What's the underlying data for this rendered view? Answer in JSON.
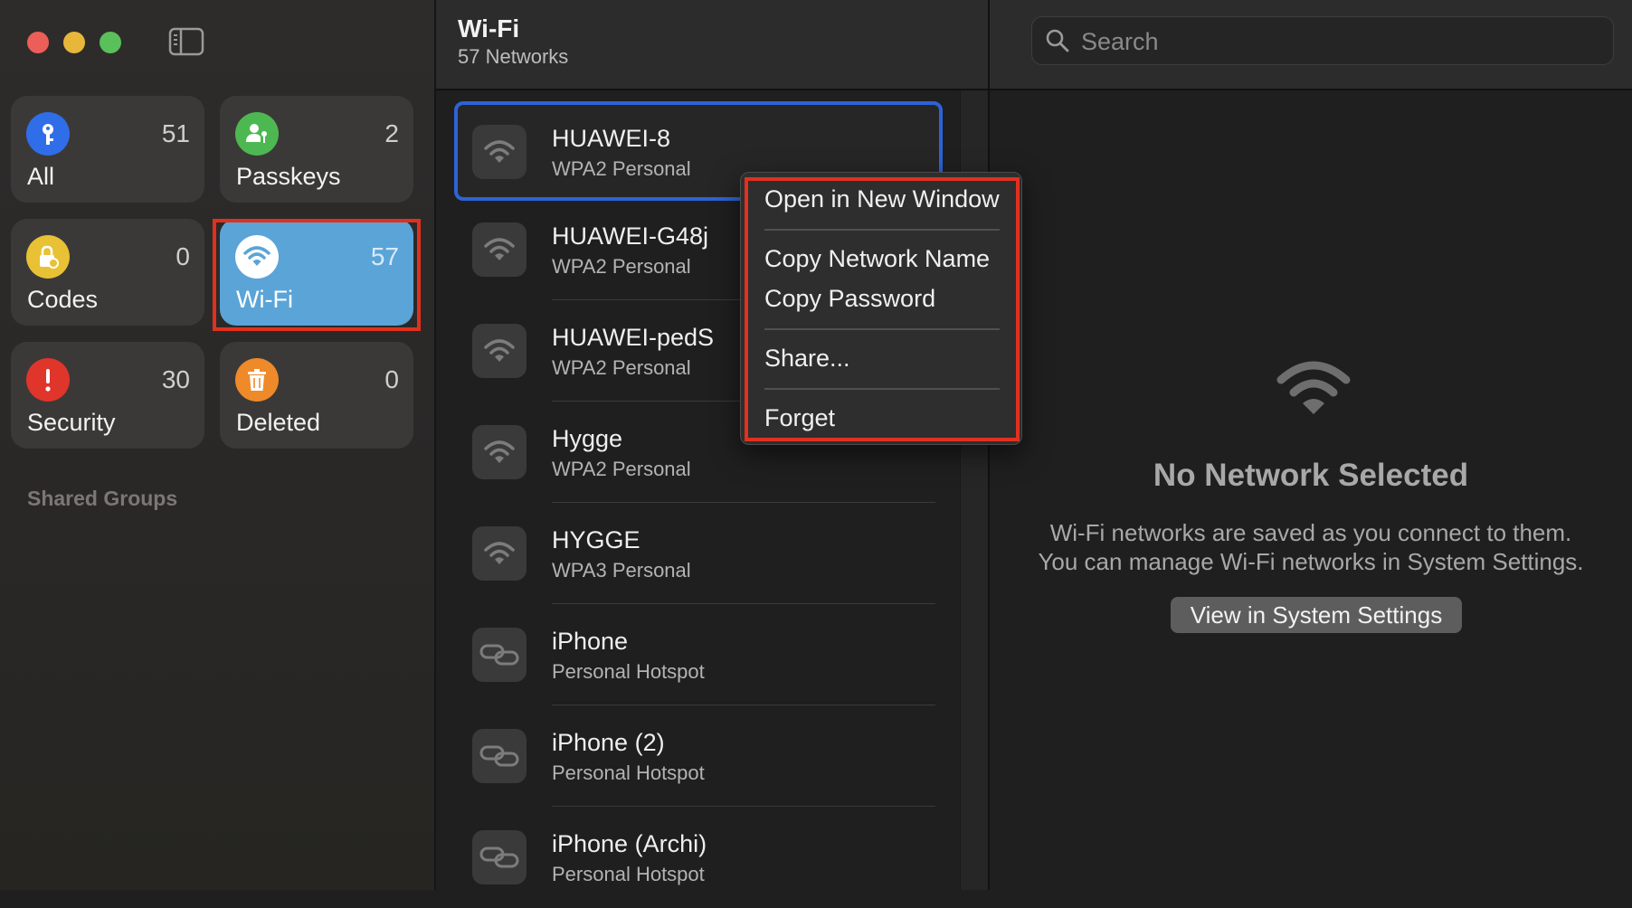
{
  "colors": {
    "accent": "#2e63d6",
    "highlight": "#e0311e",
    "wifi_tile_selected": "#5ba4d8"
  },
  "sidebar": {
    "toggle_icon": "sidebar-toggle-icon",
    "categories": [
      {
        "label": "All",
        "count": "51",
        "icon": "key-icon",
        "color": "#2f6ee8"
      },
      {
        "label": "Passkeys",
        "count": "2",
        "icon": "person-key-icon",
        "color": "#4db851"
      },
      {
        "label": "Codes",
        "count": "0",
        "icon": "lock-clock-icon",
        "color": "#e8c135"
      },
      {
        "label": "Wi-Fi",
        "count": "57",
        "icon": "wifi-icon",
        "color": "#ffffff",
        "selected": true
      },
      {
        "label": "Security",
        "count": "30",
        "icon": "exclamation-icon",
        "color": "#e0352b"
      },
      {
        "label": "Deleted",
        "count": "0",
        "icon": "trash-icon",
        "color": "#ee8a2a"
      }
    ],
    "shared_groups_label": "Shared Groups"
  },
  "list": {
    "title": "Wi-Fi",
    "subtitle": "57 Networks",
    "networks": [
      {
        "name": "HUAWEI-8",
        "security": "WPA2 Personal",
        "icon": "wifi-icon",
        "selected": true
      },
      {
        "name": "HUAWEI-G48j",
        "security": "WPA2 Personal",
        "icon": "wifi-icon"
      },
      {
        "name": "HUAWEI-pedS",
        "security": "WPA2 Personal",
        "icon": "wifi-icon"
      },
      {
        "name": "Hygge",
        "security": "WPA2 Personal",
        "icon": "wifi-icon"
      },
      {
        "name": "HYGGE",
        "security": "WPA3 Personal",
        "icon": "wifi-icon"
      },
      {
        "name": "iPhone",
        "security": "Personal Hotspot",
        "icon": "link-icon"
      },
      {
        "name": "iPhone (2)",
        "security": "Personal Hotspot",
        "icon": "link-icon"
      },
      {
        "name": "iPhone (Archi)",
        "security": "Personal Hotspot",
        "icon": "link-icon"
      }
    ]
  },
  "search": {
    "placeholder": "Search",
    "value": ""
  },
  "detail": {
    "empty_title": "No Network Selected",
    "empty_line1": "Wi-Fi networks are saved as you connect to them.",
    "empty_line2": "You can manage Wi-Fi networks in System Settings.",
    "button_label": "View in System Settings"
  },
  "context_menu": {
    "open_new_window": "Open in New Window",
    "copy_network_name": "Copy Network Name",
    "copy_password": "Copy Password",
    "share": "Share...",
    "forget": "Forget"
  }
}
